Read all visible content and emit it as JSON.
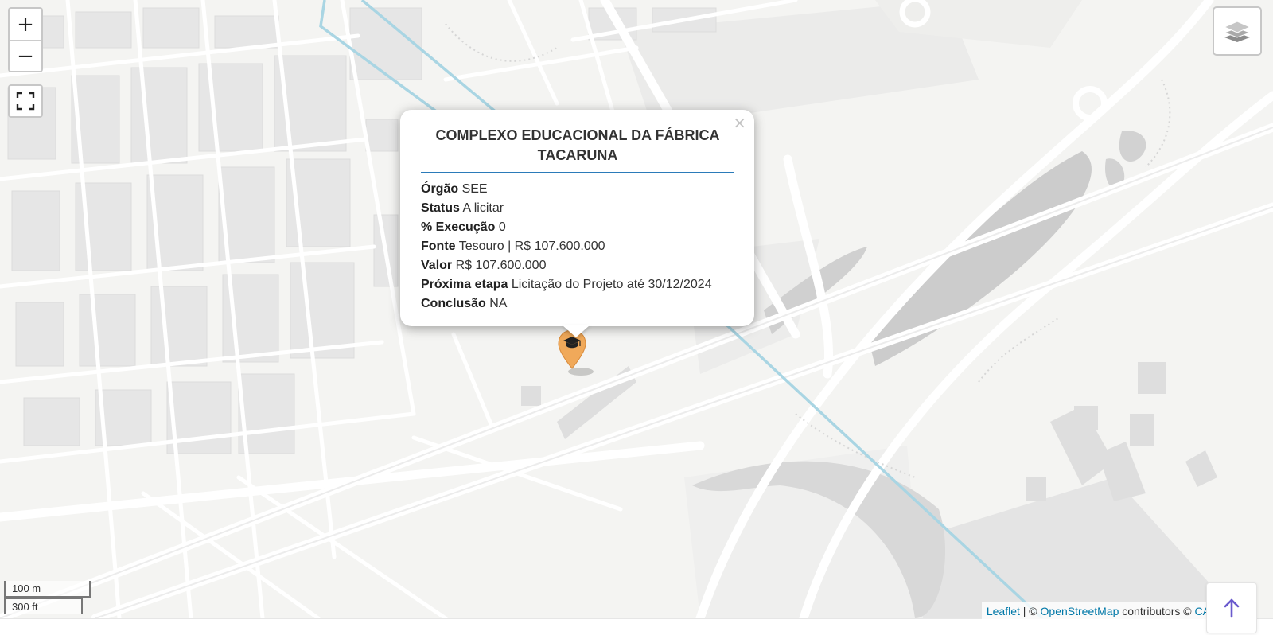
{
  "zoom": {
    "in_label": "+",
    "out_label": "−"
  },
  "controls": {
    "fullscreen_icon": "fullscreen-icon",
    "layers_icon": "layers-icon",
    "back_to_top_icon": "arrow-up-icon"
  },
  "popup": {
    "close_label": "×",
    "title": "COMPLEXO EDUCACIONAL DA FÁBRICA TACARUNA",
    "fields": [
      {
        "key": "Órgão",
        "value": "SEE"
      },
      {
        "key": "Status",
        "value": "A licitar"
      },
      {
        "key": "% Execução",
        "value": "0"
      },
      {
        "key": "Fonte",
        "value": "Tesouro | R$ 107.600.000"
      },
      {
        "key": "Valor",
        "value": "R$ 107.600.000"
      },
      {
        "key": "Próxima etapa",
        "value": "Licitação do Projeto até 30/12/2024"
      },
      {
        "key": "Conclusão",
        "value": "NA"
      }
    ]
  },
  "marker": {
    "icon": "graduation-cap-icon",
    "color": "#f0a95a"
  },
  "scale": {
    "metric": "100 m",
    "imperial": "300 ft"
  },
  "attribution": {
    "leaflet": "Leaflet",
    "sep": " | © ",
    "osm": "OpenStreetMap",
    "contributors": " contributors © ",
    "carto": "CARTO"
  },
  "colors": {
    "rail_line": "#a9d5e3",
    "popup_rule": "#2b7bb9",
    "link": "#0078a8"
  }
}
